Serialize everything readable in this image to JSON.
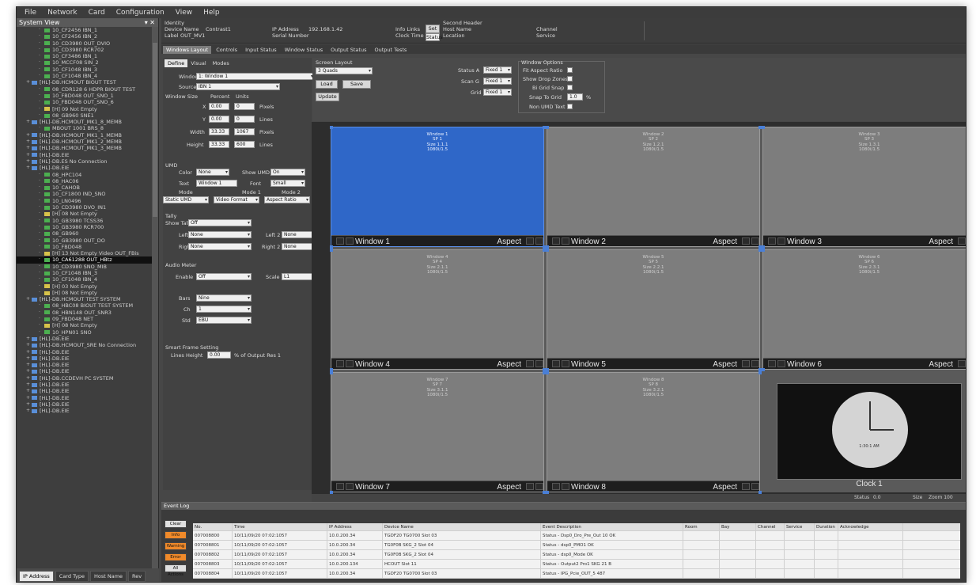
{
  "menu": [
    "File",
    "Network",
    "Card",
    "Configuration",
    "View",
    "Help"
  ],
  "sidebar": {
    "title": "System View",
    "items": [
      {
        "label": "10_CF2456 IBN_1",
        "level": 3,
        "icon": "green"
      },
      {
        "label": "10_CF2456 IBN_2",
        "level": 3,
        "icon": "green"
      },
      {
        "label": "10_CD3980 OUT_DVIO",
        "level": 3,
        "icon": "green"
      },
      {
        "label": "10_CD3980 RCR702",
        "level": 3,
        "icon": "green"
      },
      {
        "label": "10_CF3486 IBN_1",
        "level": 3,
        "icon": "green"
      },
      {
        "label": "10_MCCF08 SIN_2",
        "level": 3,
        "icon": "green"
      },
      {
        "label": "10_CF1048 IBN_3",
        "level": 3,
        "icon": "green"
      },
      {
        "label": "10_CF1048 IBN_4",
        "level": 3,
        "icon": "green"
      },
      {
        "label": "[HL]-DB.HCMOUT BIOUT TEST",
        "level": 1,
        "icon": "blue"
      },
      {
        "label": "08_CDR128 6 HDPR BIOUT TEST",
        "level": 3,
        "icon": "green"
      },
      {
        "label": "10_FBD048 OUT_SNO_1",
        "level": 3,
        "icon": "green"
      },
      {
        "label": "10_FBD048 OUT_SNO_6",
        "level": 3,
        "icon": "green"
      },
      {
        "label": "[H] 09 Not Empty",
        "level": 3,
        "icon": "yellow"
      },
      {
        "label": "08_GB960 SNE1",
        "level": 3,
        "icon": "green"
      },
      {
        "label": "[HL]-DB.HCMOUT_MK1_8_MEMB",
        "level": 1,
        "icon": "blue"
      },
      {
        "label": "MBOUT 1001 BRS_8",
        "level": 3,
        "icon": "green"
      },
      {
        "label": "[HL]-DB.HCMOUT_MK1_1_MEMB",
        "level": 1,
        "icon": "blue"
      },
      {
        "label": "[HL]-DB.HCMOUT_MK1_2_MEMB",
        "level": 1,
        "icon": "blue"
      },
      {
        "label": "[HL]-DB.HCMOUT_MK1_3_MEMB",
        "level": 1,
        "icon": "blue"
      },
      {
        "label": "[HL]-DB.EIE",
        "level": 1,
        "icon": "blue"
      },
      {
        "label": "[HL]-DB.ES No Connection",
        "level": 1,
        "icon": "blue"
      },
      {
        "label": "[HL]-DB.EIE",
        "level": 1,
        "icon": "blue"
      },
      {
        "label": "08_HPC104",
        "level": 3,
        "icon": "green"
      },
      {
        "label": "08_HAC06",
        "level": 3,
        "icon": "green"
      },
      {
        "label": "10_CAHOB",
        "level": 3,
        "icon": "green"
      },
      {
        "label": "10_CF1800 IND_SNO",
        "level": 3,
        "icon": "green"
      },
      {
        "label": "10_LN0496",
        "level": 3,
        "icon": "green"
      },
      {
        "label": "10_CD3980 DVO_IN1",
        "level": 3,
        "icon": "green"
      },
      {
        "label": "[H] 08 Not Empty",
        "level": 3,
        "icon": "yellow"
      },
      {
        "label": "10_GB3980 TCSS36",
        "level": 3,
        "icon": "green"
      },
      {
        "label": "10_GB3980 RCR700",
        "level": 3,
        "icon": "green"
      },
      {
        "label": "08_GB960",
        "level": 3,
        "icon": "green"
      },
      {
        "label": "10_GB3980 OUT_DO",
        "level": 3,
        "icon": "green"
      },
      {
        "label": "10_FBD048",
        "level": 3,
        "icon": "green"
      },
      {
        "label": "[H] 13 Not Empty Video OUT_FBis",
        "level": 3,
        "icon": "yellow"
      },
      {
        "label": "10_CA61288 OUT_HBtz",
        "level": 3,
        "icon": "green",
        "selected": true
      },
      {
        "label": "10_CD3980 SNO_MIB",
        "level": 3,
        "icon": "green"
      },
      {
        "label": "10_CF1048 IBN_3",
        "level": 3,
        "icon": "green"
      },
      {
        "label": "10_CF1048 IBN_4",
        "level": 3,
        "icon": "green"
      },
      {
        "label": "[H] 03 Not Empty",
        "level": 3,
        "icon": "yellow"
      },
      {
        "label": "[H] 08 Not Empty",
        "level": 3,
        "icon": "yellow"
      },
      {
        "label": "[HL]-DB.HCMOUT TEST SYSTEM",
        "level": 1,
        "icon": "blue"
      },
      {
        "label": "08_HBC08 BIOUT TEST SYSTEM",
        "level": 3,
        "icon": "green"
      },
      {
        "label": "08_HBN148 OUT_SNR3",
        "level": 3,
        "icon": "green"
      },
      {
        "label": "09_FBD048 NET",
        "level": 3,
        "icon": "green"
      },
      {
        "label": "[H] 08 Not Empty",
        "level": 3,
        "icon": "yellow"
      },
      {
        "label": "10_HPN01 SNO",
        "level": 3,
        "icon": "green"
      },
      {
        "label": "[HL]-DB.EIE",
        "level": 1,
        "icon": "blue"
      },
      {
        "label": "[HL]-DB.HCMOUT_SRE No Connection",
        "level": 1,
        "icon": "blue"
      },
      {
        "label": "[HL]-DB.EIE",
        "level": 1,
        "icon": "blue"
      },
      {
        "label": "[HL]-DB.EIE",
        "level": 1,
        "icon": "blue"
      },
      {
        "label": "[HL]-DB.EIE",
        "level": 1,
        "icon": "blue"
      },
      {
        "label": "[HL]-DB.EIE",
        "level": 1,
        "icon": "blue"
      },
      {
        "label": "[HL]-DB.CCDEVH PC SYSTEM",
        "level": 1,
        "icon": "blue"
      },
      {
        "label": "[HL]-DB.EIE",
        "level": 1,
        "icon": "blue"
      },
      {
        "label": "[HL]-DB.EIE",
        "level": 1,
        "icon": "blue"
      },
      {
        "label": "[HL]-DB.EIE",
        "level": 1,
        "icon": "blue"
      },
      {
        "label": "[HL]-DB.EIE",
        "level": 1,
        "icon": "blue"
      },
      {
        "label": "[HL]-DB.EIE",
        "level": 1,
        "icon": "blue"
      }
    ],
    "bottom_tabs": [
      "IP Address",
      "Card Type",
      "Host Name",
      "Rev"
    ]
  },
  "infobar": {
    "identity_label": "Identity",
    "device_label": "Device Name",
    "device_value": "Contrast1",
    "label_label": "Label",
    "label_value": "OUT_MV1",
    "ip_label": "IP Address",
    "ip_value": "192.168.1.42",
    "serial_label": "Serial Number",
    "info_label": "Info Links",
    "info_btn": "Set",
    "clock_label": "Clock Time",
    "status_btn": "Status",
    "second_label": "Second Header",
    "hostname_label": "Host Name",
    "location_label": "Location",
    "channel_label": "Channel",
    "channel_value": "Service"
  },
  "tabs": [
    "Windows Layout",
    "Controls",
    "Input Status",
    "Window Status",
    "Output Status",
    "Output Tests"
  ],
  "props": {
    "subtabs": [
      "Define",
      "Visual",
      "Modes"
    ],
    "window_label": "Window",
    "window_value": "1: Window 1",
    "source_label": "Source",
    "source_value": "IBN 1",
    "size_label": "Window Size",
    "col_percent": "Percent",
    "col_units": "Units",
    "rows": [
      {
        "label": "X",
        "pct": "0.00",
        "units": "0",
        "unit": "Pixels"
      },
      {
        "label": "Y",
        "pct": "0.00",
        "units": "0",
        "unit": "Lines"
      },
      {
        "label": "Width",
        "pct": "33.33",
        "units": "1067",
        "unit": "Pixels"
      },
      {
        "label": "Height",
        "pct": "33.33",
        "units": "600",
        "unit": "Lines"
      }
    ],
    "umd_label": "UMD",
    "umd_color_label": "Color",
    "umd_color": "None",
    "umd_show_label": "Show UMD",
    "umd_show": "On",
    "umd_text_label": "Text",
    "umd_text": "Window 1",
    "umd_font_label": "Font",
    "umd_font": "Small",
    "mode_label": "Mode",
    "mode1_label": "Mode 1",
    "mode2_label": "Mode 2",
    "mode_a": "Static UMD",
    "mode_b": "Video Format",
    "mode_c": "Aspect Ratio",
    "tally_label": "Tally",
    "show_tally_label": "Show Tally",
    "show_tally": "Off",
    "left_label": "Left",
    "left_value": "None",
    "left2_label": "Left 2",
    "left2_value": "None",
    "right_label": "Right",
    "right_value": "None",
    "right2_label": "Right 2",
    "right2_value": "None",
    "audio_label": "Audio Meter",
    "enable_label": "Enable",
    "enable_value": "Off",
    "scale_label": "Scale",
    "scale_value": "L1",
    "bars_label": "Bars",
    "bars_value": "Nine",
    "ch_label": "Ch",
    "ch_value": "1",
    "std_label": "Std",
    "std_value": "EBU",
    "smart_label": "Smart Frame Setting",
    "lines_label": "Lines Height",
    "lines_value": "0.00",
    "lines_suffix": "% of Output Res 1"
  },
  "toolstrip": {
    "screen_layout": "Screen Layout",
    "layout_value": "3 Quads",
    "load_btn": "Load",
    "save_btn": "Save",
    "update_btn": "Update",
    "status_a_label": "Status A",
    "status_a": "Fixed 1",
    "scan_label": "Scan G",
    "scan_value": "Fixed 1",
    "grid_label": "Grid",
    "grid_value": "Fixed 1",
    "opts_title": "Window Options",
    "opt1": "Fit Aspect Ratio",
    "opt2": "Show Drop Zones",
    "opt3": "Bi Grid Snap",
    "opt4_label": "Snap To Grid",
    "opt4_value": "1.0",
    "opt4_suffix": "%",
    "opt5": "Non UMD Text"
  },
  "windows": [
    {
      "name": "Window 1",
      "aspect": "Aspect",
      "lines": [
        "Window 1",
        "SP 1",
        "Size 1.1.1",
        "1080i/1.5"
      ],
      "highlight": true
    },
    {
      "name": "Window 2",
      "aspect": "Aspect",
      "lines": [
        "Window 2",
        "SP 2",
        "Size 1.2.1",
        "1080i/1.5"
      ]
    },
    {
      "name": "Window 3",
      "aspect": "Aspect",
      "lines": [
        "Window 3",
        "SP 3",
        "Size 1.3.1",
        "1080i/1.5"
      ]
    },
    {
      "name": "Window 4",
      "aspect": "Aspect",
      "lines": [
        "Window 4",
        "SP 4",
        "Size 2.1.1",
        "1080i/1.5"
      ]
    },
    {
      "name": "Window 5",
      "aspect": "Aspect",
      "lines": [
        "Window 5",
        "SP 5",
        "Size 2.2.1",
        "1080i/1.5"
      ]
    },
    {
      "name": "Window 6",
      "aspect": "Aspect",
      "lines": [
        "Window 6",
        "SP 6",
        "Size 2.3.1",
        "1080i/1.5"
      ]
    },
    {
      "name": "Window 7",
      "aspect": "Aspect",
      "lines": [
        "Window 7",
        "SP 7",
        "Size 3.1.1",
        "1080i/1.5"
      ]
    },
    {
      "name": "Window 8",
      "aspect": "Aspect",
      "lines": [
        "Window 8",
        "SP 8",
        "Size 3.2.1",
        "1080i/1.5"
      ]
    }
  ],
  "clock": {
    "name": "Clock 1",
    "face_text": "1:30:1 AM"
  },
  "status": {
    "left": "Status",
    "left_value": "0.0",
    "right": "Size",
    "right_value": "Zoom 100"
  },
  "eventlog": {
    "title": "Event Log",
    "buttons": [
      {
        "label": "Clear",
        "color": "#e0e0e0"
      },
      {
        "label": "Info",
        "color": "#f08a2a"
      },
      {
        "label": "Warning",
        "color": "#f08a2a"
      },
      {
        "label": "Error",
        "color": "#f08a2a"
      },
      {
        "label": "All Actions",
        "color": "#e0e0e0"
      }
    ],
    "columns": [
      "No.",
      "Time",
      "IP Address",
      "Device Name",
      "Event Description",
      "Room",
      "Bay",
      "Channel",
      "Service",
      "Duration",
      "Acknowledge"
    ],
    "rows": [
      [
        "007008800",
        "10/11/09/20 07:02:1057",
        "10.0.200.34",
        "TGDF20 TG0700 Slot 03",
        "Status - Dsp0_Dro_Pre_Out 10 OK",
        "",
        "",
        "",
        "",
        "",
        ""
      ],
      [
        "007008801",
        "10/11/09/20 07:02:1057",
        "10.0.200.34",
        "TG0F0B SKG_2 Slot 04",
        "Status - dsp0_PMO1 OK",
        "",
        "",
        "",
        "",
        "",
        ""
      ],
      [
        "007008802",
        "10/11/09/20 07:02:1057",
        "10.0.200.34",
        "TG0F0B SKG_2 Slot 04",
        "Status - dsp0_Mode OK",
        "",
        "",
        "",
        "",
        "",
        ""
      ],
      [
        "007008803",
        "10/11/09/20 07:02:1057",
        "10.0.200.134",
        "HCOUT Slot 11",
        "Status - Output2 Pro1 SKG 21 B",
        "",
        "",
        "",
        "",
        "",
        ""
      ],
      [
        "007008804",
        "10/11/09/20 07:02:1057",
        "10.0.200.34",
        "TGDF20 TG0700 Slot 03",
        "Status - IPG_Pcie_OUT_5 487",
        "",
        "",
        "",
        "",
        "",
        ""
      ]
    ]
  },
  "colors": {
    "app_bg": "#474747",
    "selected_window": "#2f67c8",
    "window_bg": "#7d7d7d",
    "alert_button": "#f08a2a"
  }
}
